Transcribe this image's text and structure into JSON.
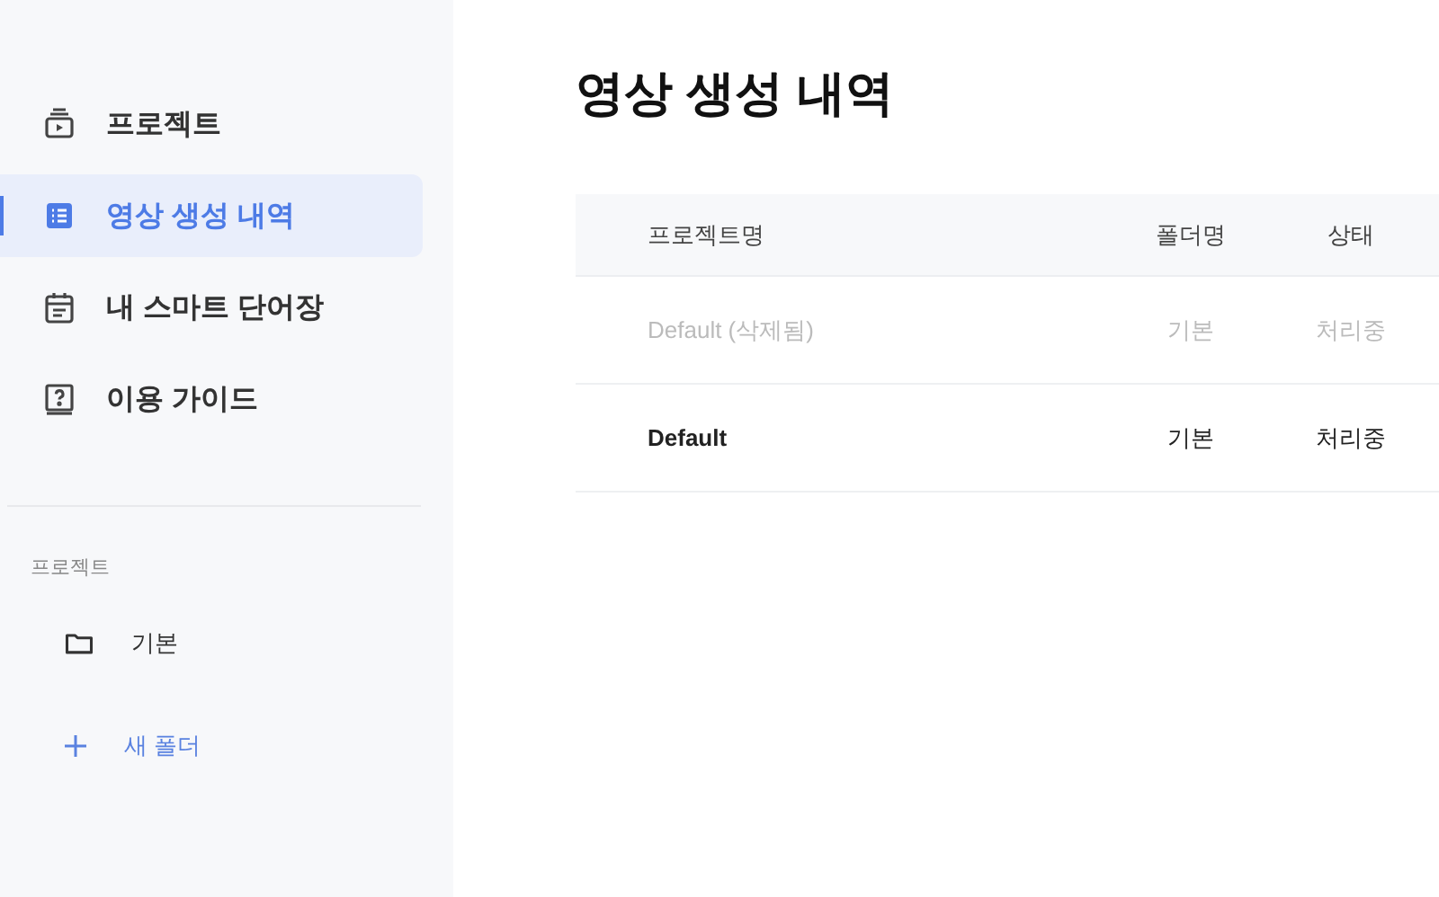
{
  "sidebar": {
    "nav_items": [
      {
        "label": "프로젝트",
        "kind": "project",
        "selected": false
      },
      {
        "label": "영상 생성 내역",
        "kind": "history",
        "selected": true
      },
      {
        "label": "내 스마트 단어장",
        "kind": "vocab",
        "selected": false
      },
      {
        "label": "이용 가이드",
        "kind": "guide",
        "selected": false
      }
    ],
    "section_title": "프로젝트",
    "folders": [
      {
        "label": "기본"
      }
    ],
    "new_folder": "새 폴더"
  },
  "main": {
    "title": "영상 생성 내역",
    "table": {
      "columns": [
        "프로젝트명",
        "폴더명",
        "상태"
      ],
      "rows": [
        {
          "cells": [
            "Default (삭제됨)",
            "기본",
            "처리중"
          ],
          "deleted": true
        },
        {
          "cells": [
            "Default",
            "기본",
            "처리중"
          ],
          "deleted": false
        }
      ]
    }
  }
}
